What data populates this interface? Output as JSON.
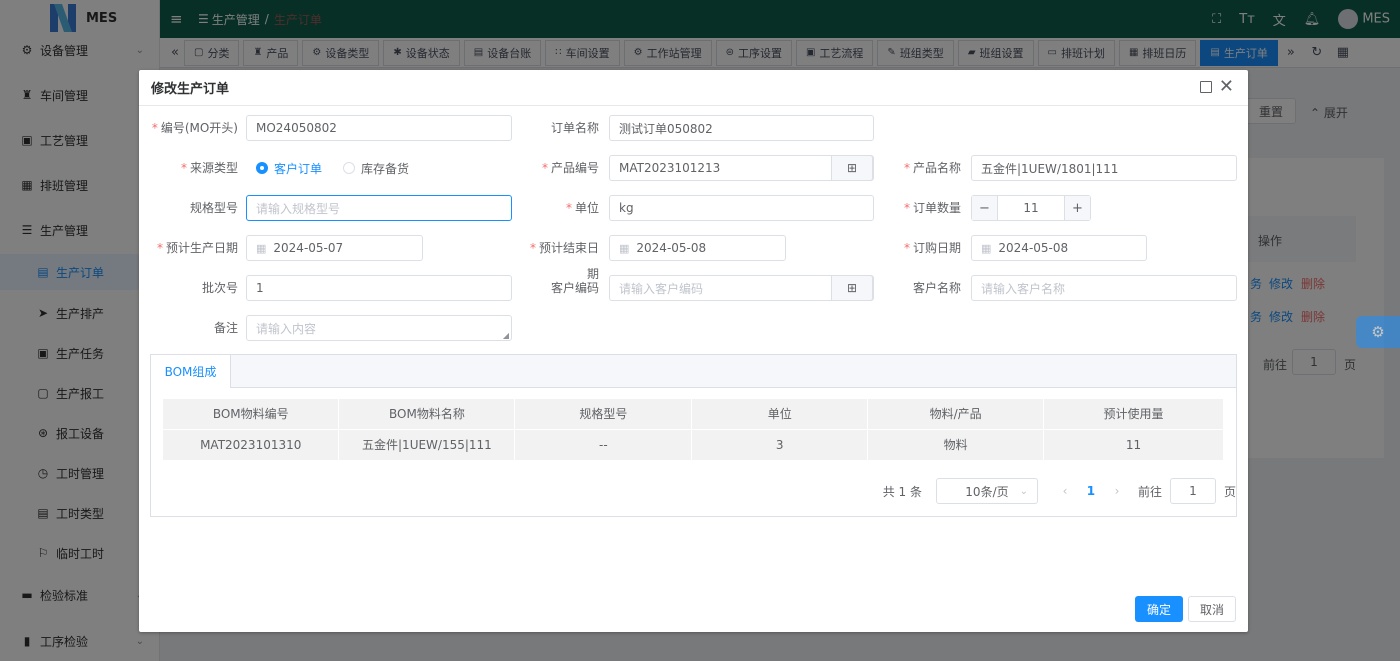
{
  "app": {
    "name": "MES"
  },
  "sidebar": {
    "items": [
      {
        "label": "设备管理",
        "icon": "gear-icon"
      },
      {
        "label": "车间管理",
        "icon": "workshop-icon"
      },
      {
        "label": "工艺管理",
        "icon": "process-icon"
      },
      {
        "label": "排班管理",
        "icon": "calendar-icon"
      },
      {
        "label": "生产管理",
        "icon": "database-icon"
      },
      {
        "label": "检验标准",
        "icon": "monitor-icon"
      },
      {
        "label": "工序检验",
        "icon": "book-icon"
      }
    ],
    "sub_items": [
      {
        "label": "生产订单",
        "icon": "document-icon"
      },
      {
        "label": "生产排产",
        "icon": "send-icon"
      },
      {
        "label": "生产任务",
        "icon": "task-icon"
      },
      {
        "label": "生产报工",
        "icon": "report-icon"
      },
      {
        "label": "报工设备",
        "icon": "device-icon"
      },
      {
        "label": "工时管理",
        "icon": "clock-icon"
      },
      {
        "label": "工时类型",
        "icon": "list-icon"
      },
      {
        "label": "临时工时",
        "icon": "flag-icon"
      }
    ]
  },
  "topbar": {
    "breadcrumb_1": "生产管理",
    "breadcrumb_sep": "/",
    "breadcrumb_2": "生产订单",
    "user": "MES"
  },
  "tags": [
    "分类",
    "产品",
    "设备类型",
    "设备状态",
    "设备台账",
    "车间设置",
    "工作站管理",
    "工序设置",
    "工艺流程",
    "班组类型",
    "班组设置",
    "排班计划",
    "排班日历",
    "生产订单"
  ],
  "background": {
    "reset": "重置",
    "expand": "展开",
    "ops_header": "操作",
    "row_links": [
      "务",
      "修改",
      "删除"
    ],
    "goto": "前往",
    "goto_page": "1",
    "page_unit": "页"
  },
  "dialog": {
    "title": "修改生产订单",
    "fields": {
      "code_label": "编号(MO开头)",
      "code_value": "MO24050802",
      "order_name_label": "订单名称",
      "order_name_value": "测试订单050802",
      "source_label": "来源类型",
      "source_opt1": "客户订单",
      "source_opt2": "库存备货",
      "product_code_label": "产品编号",
      "product_code_value": "MAT2023101213",
      "product_name_label": "产品名称",
      "product_name_value": "五金件|1UEW/1801|111",
      "spec_label": "规格型号",
      "spec_placeholder": "请输入规格型号",
      "unit_label": "单位",
      "unit_value": "kg",
      "qty_label": "订单数量",
      "qty_value": "11",
      "plan_start_label": "预计生产日期",
      "plan_start_value": "2024-05-07",
      "plan_end_label": "预计结束日期",
      "plan_end_value": "2024-05-08",
      "order_date_label": "订购日期",
      "order_date_value": "2024-05-08",
      "batch_label": "批次号",
      "batch_value": "1",
      "cust_code_label": "客户编码",
      "cust_code_placeholder": "请输入客户编码",
      "cust_name_label": "客户名称",
      "cust_name_placeholder": "请输入客户名称",
      "remark_label": "备注",
      "remark_placeholder": "请输入内容"
    },
    "bom": {
      "tab": "BOM组成",
      "columns": [
        "BOM物料编号",
        "BOM物料名称",
        "规格型号",
        "单位",
        "物料/产品",
        "预计使用量"
      ],
      "rows": [
        [
          "MAT2023101310",
          "五金件|1UEW/155|111",
          "--",
          "3",
          "物料",
          "11"
        ]
      ],
      "total": "共 1 条",
      "page_size": "10条/页",
      "current_page": "1",
      "goto": "前往",
      "goto_page": "1",
      "page_unit": "页"
    },
    "ok": "确定",
    "cancel": "取消"
  },
  "colors": {
    "topbar": "#0f5f4c",
    "accent": "#1890ff",
    "danger": "#f56c6c"
  }
}
